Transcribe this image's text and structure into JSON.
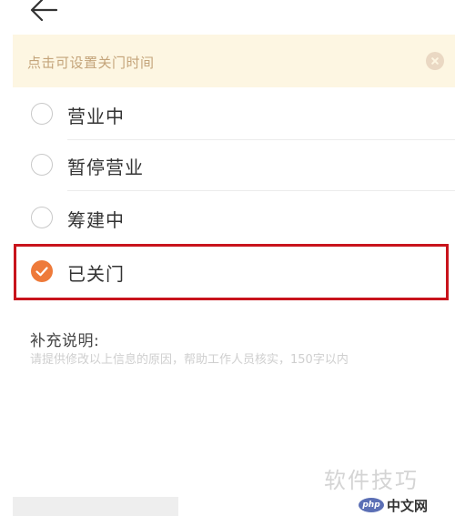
{
  "notice": {
    "text": "点击可设置关门时间"
  },
  "status_options": [
    {
      "label": "营业中",
      "checked": false
    },
    {
      "label": "暂停营业",
      "checked": false
    },
    {
      "label": "筹建中",
      "checked": false
    },
    {
      "label": "已关门",
      "checked": true
    }
  ],
  "supplement": {
    "title": "补充说明:",
    "placeholder": "请提供修改以上信息的原因，帮助工作人员核实，150字以内"
  },
  "watermark": {
    "text": "软件技巧",
    "logo": "php",
    "site": "中文网"
  },
  "colors": {
    "accent": "#ee7a3a",
    "notice_bg": "#fdf6e2",
    "notice_text": "#c4a47a",
    "highlight_border": "#c8141c"
  },
  "icons": {
    "back": "arrow-left-icon",
    "close": "close-circle-icon",
    "check": "check-icon"
  }
}
